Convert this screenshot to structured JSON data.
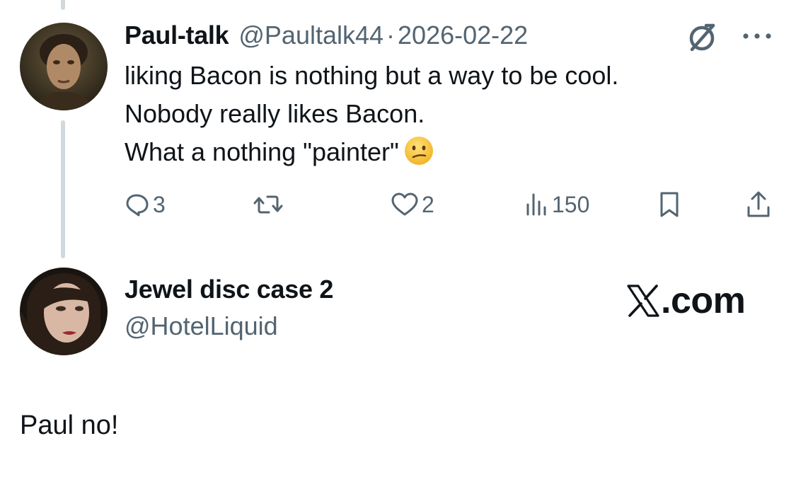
{
  "original_tweet": {
    "display_name": "Paul-talk",
    "handle": "@Paultalk44",
    "separator": "·",
    "date": "2026-02-22",
    "avatar_icon": "portrait-avatar",
    "header_icons": [
      "grok-icon",
      "more-icon"
    ],
    "body_lines": [
      "liking Bacon is nothing but a way to be cool.",
      "Nobody really likes Bacon.",
      "What a nothing \"painter\""
    ],
    "emoji": "confused-face-emoji",
    "actions": {
      "replies": "3",
      "retweets": "",
      "likes": "2",
      "views": "150"
    }
  },
  "reply_card": {
    "display_name": "Jewel disc case 2",
    "handle": "@HotelLiquid",
    "avatar_icon": "portrait-avatar",
    "brand_text": ".com",
    "reply_text": "Paul no!"
  },
  "colors": {
    "text_primary": "#0f1419",
    "text_secondary": "#536471",
    "thread_line": "#cfd9de",
    "emoji_yellow": "#f7c43a"
  }
}
